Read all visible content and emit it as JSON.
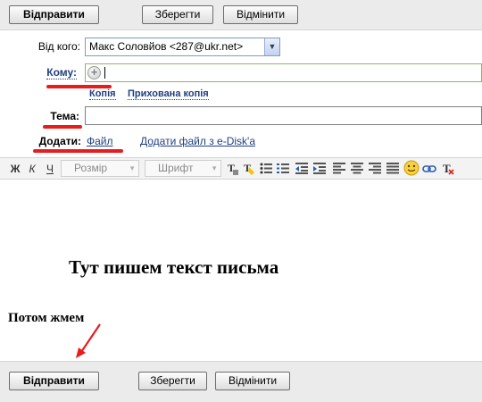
{
  "actions": {
    "send": "Відправити",
    "save": "Зберегти",
    "cancel": "Відмінити"
  },
  "compose": {
    "from_label": "Від кого:",
    "from_value": "Макс Соловйов <287@ukr.net>",
    "to_label": "Кому:",
    "to_value": "",
    "cc_link": "Копія",
    "bcc_link": "Прихована копія",
    "subject_label": "Тема:",
    "subject_value": "",
    "attach_label": "Додати:",
    "attach_file_link": "Файл",
    "attach_edisk_link": "Додати файл з e-Disk'а"
  },
  "toolbar": {
    "bold_glyph": "Ж",
    "italic_glyph": "К",
    "underline_glyph": "Ч",
    "size_placeholder": "Розмір",
    "font_placeholder": "Шрифт"
  },
  "annotations": {
    "write_here": "Тут пишем текст письма",
    "then_press": "Потом жмем",
    "highlight_color": "#e81c1c"
  },
  "colors": {
    "link": "#1f3f7f",
    "bar_bg": "#ebebeb",
    "to_field_border": "#8fb36a"
  }
}
